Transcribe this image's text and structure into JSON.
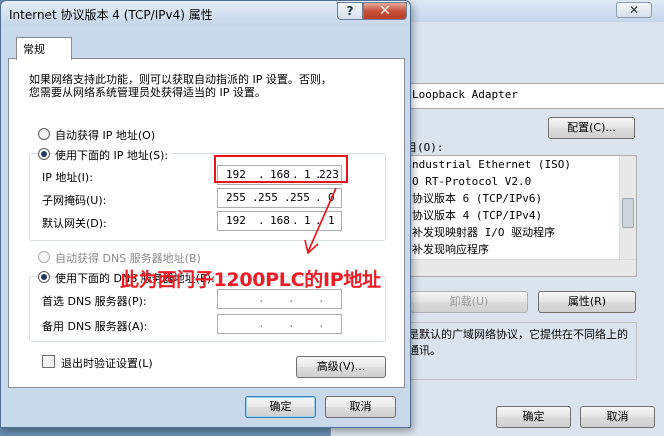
{
  "background_window": {
    "adapter_name": "Loopback Adapter",
    "configure_button": "配置(C)...",
    "items_label": "目(O):",
    "items": [
      "ndustrial Ethernet (ISO)",
      "O RT-Protocol V2.0",
      "协议版本 6 (TCP/IPv6)",
      "协议版本 4 (TCP/IPv4)",
      "补发现映射器 I/O 驱动程序",
      "补发现响应程序"
    ],
    "uninstall_button": "卸载(U)",
    "properties_button": "属性(R)",
    "description": "是默认的广域网络协议，它提供在不同络上的通讯。",
    "ok_button": "确定",
    "cancel_button": "取消",
    "close_glyph": "✕"
  },
  "dialog": {
    "title": "Internet 协议版本 4 (TCP/IPv4) 属性",
    "help_glyph": "?",
    "close_glyph": "✕",
    "tab_general": "常规",
    "intro_line1": "如果网络支持此功能，则可以获取自动指派的 IP 设置。否则，",
    "intro_line2": "您需要从网络系统管理员处获得适当的 IP 设置。",
    "auto_ip_label": "自动获得 IP 地址(O)",
    "manual_ip_label": "使用下面的 IP 地址(S):",
    "ip_label": "IP 地址(I):",
    "ip_address": [
      "192",
      "168",
      "1",
      "223"
    ],
    "subnet_label": "子网掩码(U):",
    "subnet_mask": [
      "255",
      "255",
      "255",
      "0"
    ],
    "gateway_label": "默认网关(D):",
    "gateway": [
      "192",
      "168",
      "1",
      "1"
    ],
    "auto_dns_label": "自动获得 DNS 服务器地址(B)",
    "manual_dns_label": "使用下面的 DNS 服务器地址(E):",
    "preferred_dns_label": "首选 DNS 服务器(P):",
    "alternate_dns_label": "备用 DNS 服务器(A):",
    "dns_dot": ".",
    "validate_label": "退出时验证设置(L)",
    "advanced_button": "高级(V)...",
    "ok_button": "确定",
    "cancel_button": "取消",
    "ip_dot": "."
  },
  "annotation": {
    "text": "此为西门子1200PLC的IP地址",
    "color": "#ee1c24"
  }
}
